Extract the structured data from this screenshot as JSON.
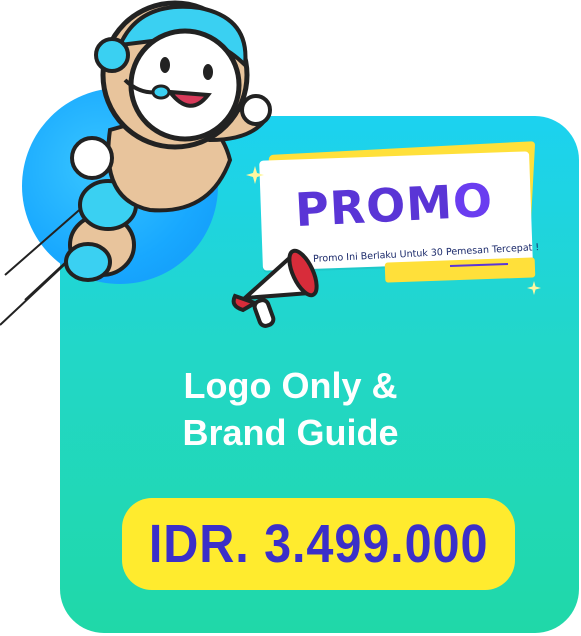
{
  "banner": {
    "title_main": "PROM",
    "title_last": "O",
    "subtitle": "Promo Ini Berlaku Untuk 30 Pemesan Tercepat !"
  },
  "headline": {
    "line1": "Logo Only &",
    "line2": "Brand Guide"
  },
  "price": {
    "label": "IDR. 3.499.000"
  },
  "colors": {
    "card_top": "#1cd2f0",
    "card_bottom": "#20d8a8",
    "pill": "#ffeb2e",
    "price_text": "#3b2fc9",
    "promo_text": "#5a35d6"
  },
  "icons": [
    "astronaut-mascot-illustration",
    "megaphone-icon",
    "sparkle-icon"
  ]
}
